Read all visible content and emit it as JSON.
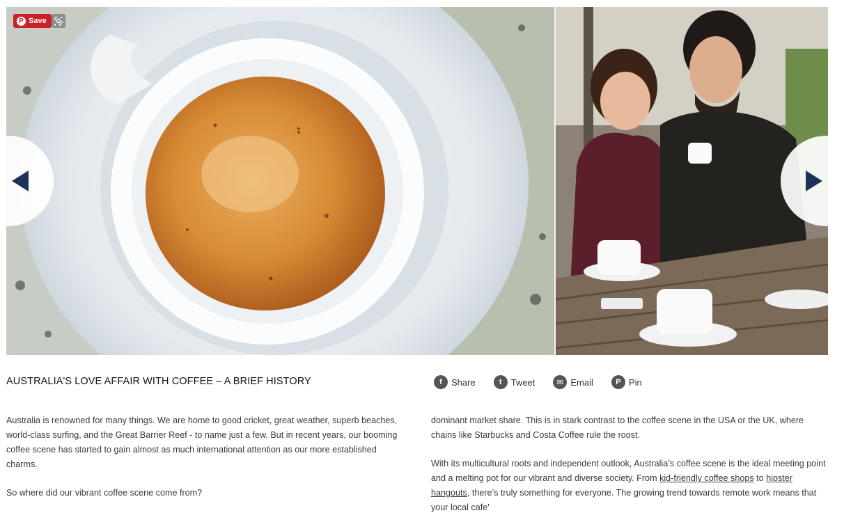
{
  "carousel": {
    "pin_save_label": "Save",
    "pin_logo_glyph": "P",
    "prev_icon": "chevron-left-icon",
    "next_icon": "chevron-right-icon"
  },
  "article": {
    "title": "AUSTRALIA'S LOVE AFFAIR WITH COFFEE – A BRIEF HISTORY",
    "share": [
      {
        "label": "Share",
        "glyph": "f",
        "icon": "facebook-icon"
      },
      {
        "label": "Tweet",
        "glyph": "t",
        "icon": "twitter-icon"
      },
      {
        "label": "Email",
        "glyph": "✉",
        "icon": "email-icon"
      },
      {
        "label": "Pin",
        "glyph": "P",
        "icon": "pinterest-icon"
      }
    ],
    "left_paragraphs": [
      "Australia is renowned for many things. We are home to good cricket, great weather, superb beaches, world-class surfing, and the Great Barrier Reef - to name just a few. But in recent years, our booming coffee scene has started to gain almost as much international attention as our more established charms.",
      "So where did our vibrant coffee scene come from?"
    ],
    "right_p1": "dominant market share. This is in stark contrast to the coffee scene in the USA or the UK, where chains like Starbucks and Costa Coffee rule the roost.",
    "right_p2_before": "With its multicultural roots and independent outlook, Australia’s coffee scene is the ideal meeting point and a melting pot for our vibrant and diverse society. From ",
    "right_p2_link1": "kid-friendly coffee shops",
    "right_p2_mid": " to ",
    "right_p2_link2": "hipster hangouts",
    "right_p2_after": ", there’s truly something for everyone. The growing trend towards remote work means that your local cafe'"
  }
}
